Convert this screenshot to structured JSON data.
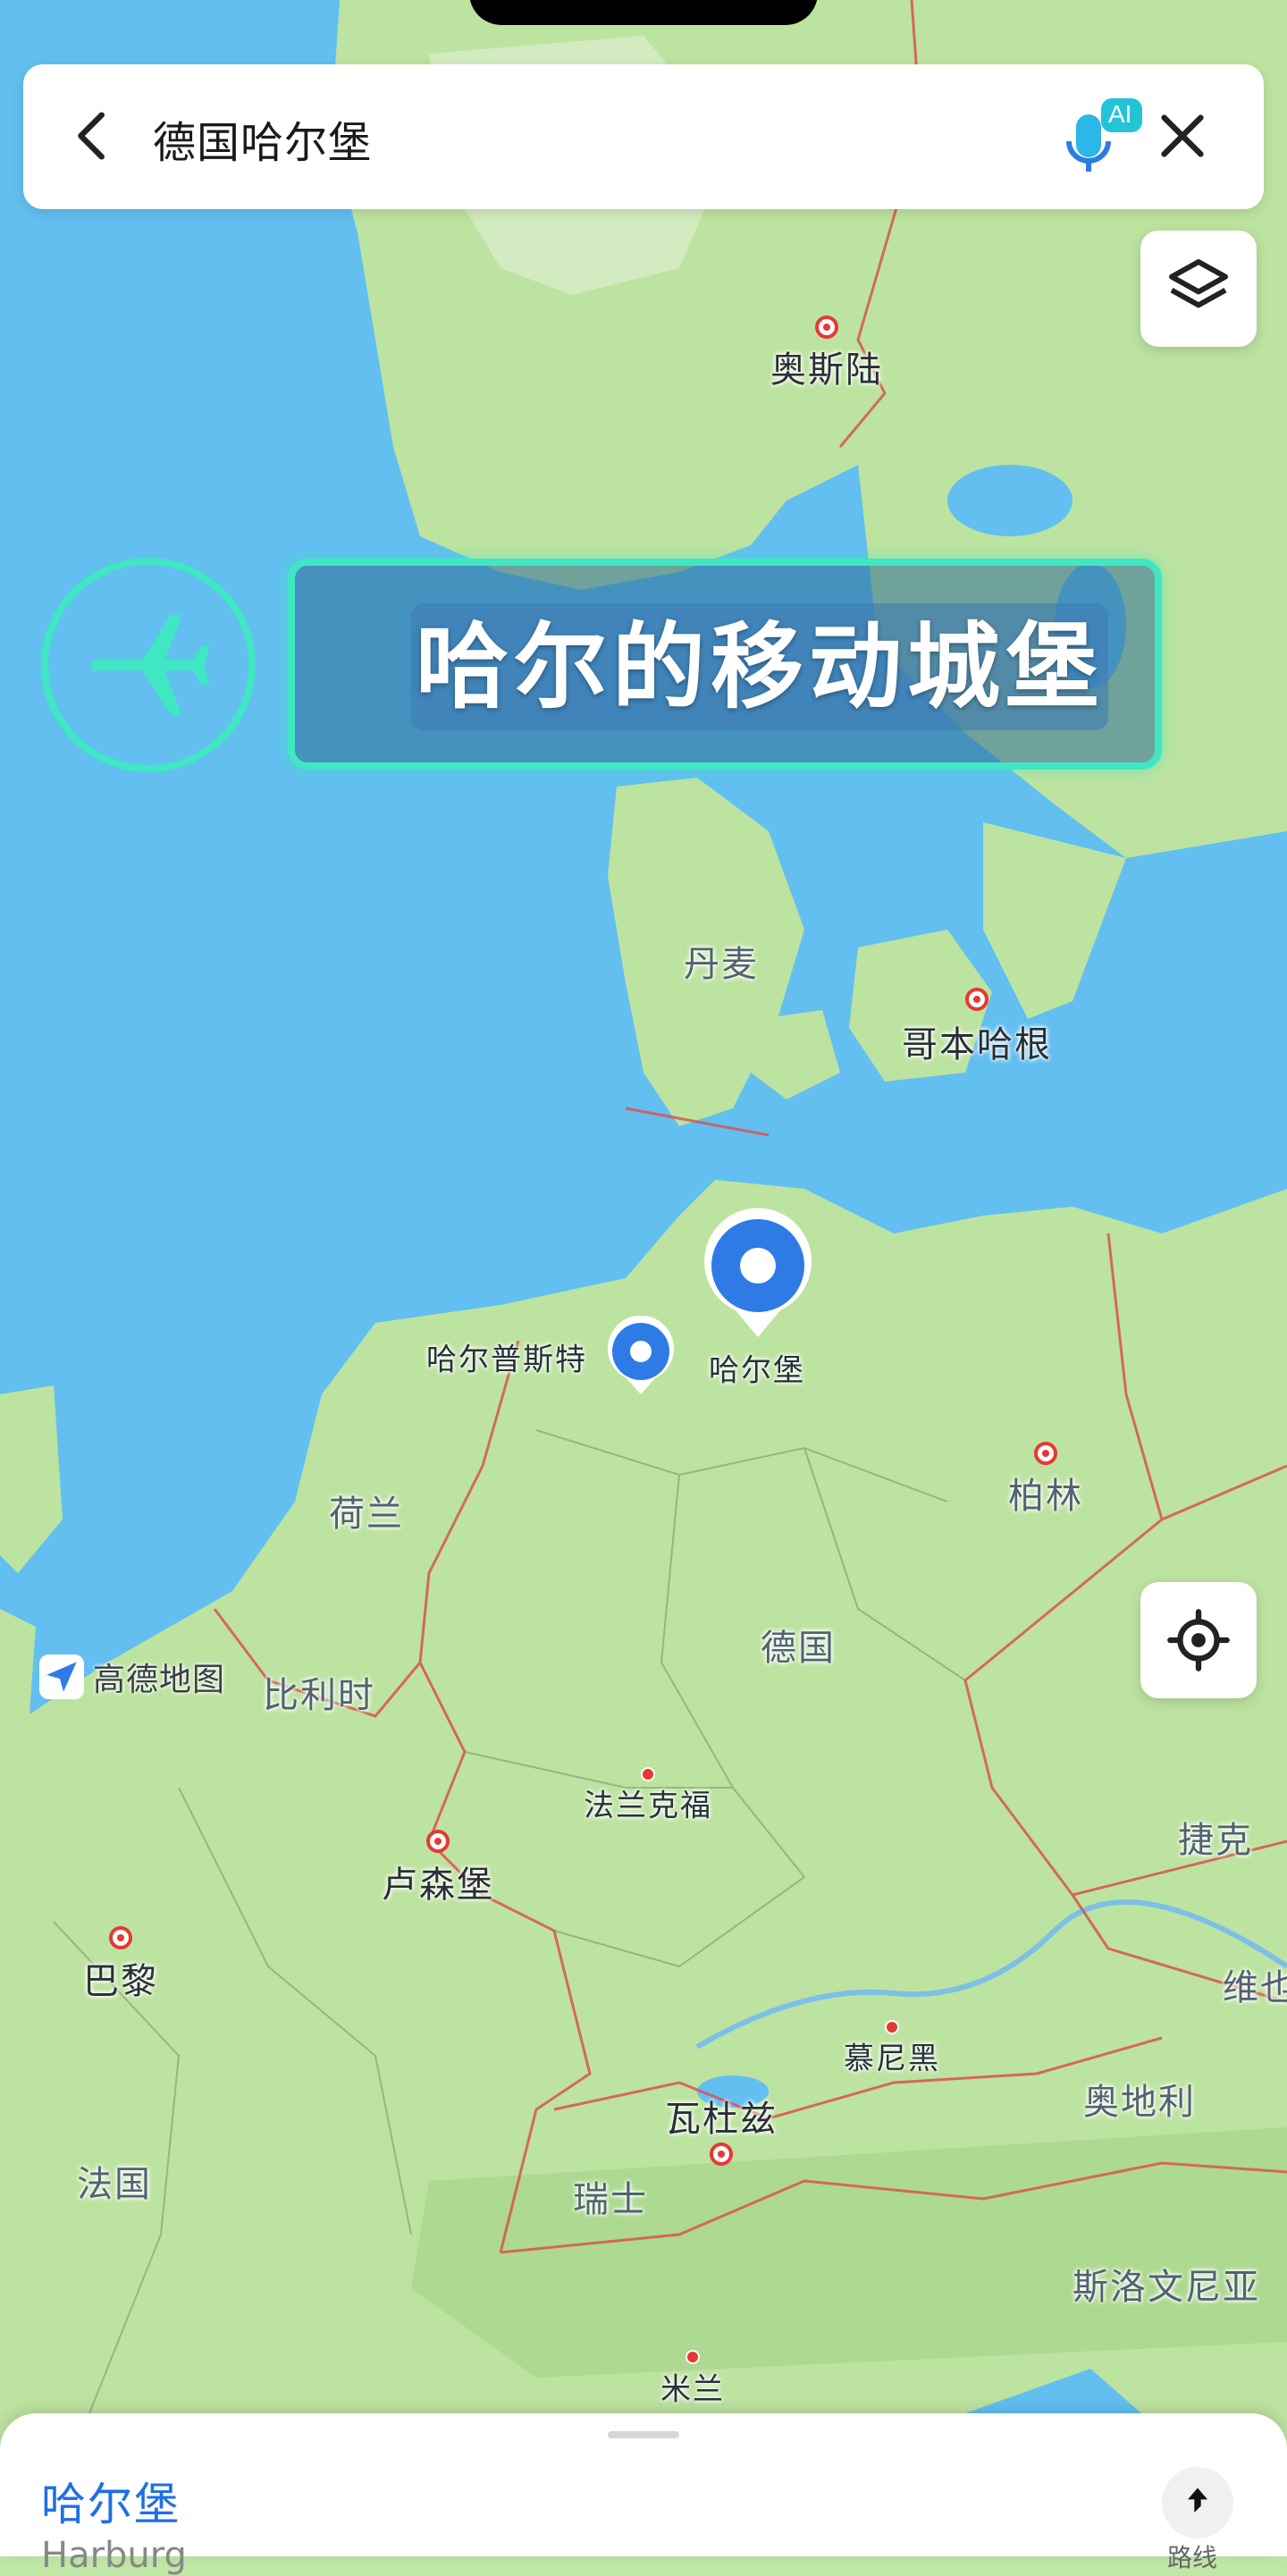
{
  "search": {
    "query": "德国哈尔堡",
    "ai_badge": "AI"
  },
  "banner": {
    "text": "哈尔的移动城堡"
  },
  "brand": {
    "name": "高德地图"
  },
  "map": {
    "labels": [
      {
        "key": "oslo",
        "text": "奥斯陆"
      },
      {
        "key": "denmark",
        "text": "丹麦"
      },
      {
        "key": "copenhagen",
        "text": "哥本哈根"
      },
      {
        "key": "harpstedt",
        "text": "哈尔普斯特"
      },
      {
        "key": "harburg",
        "text": "哈尔堡"
      },
      {
        "key": "berlin",
        "text": "柏林"
      },
      {
        "key": "netherlands",
        "text": "荷兰"
      },
      {
        "key": "germany",
        "text": "德国"
      },
      {
        "key": "belgium",
        "text": "比利时"
      },
      {
        "key": "frankfurt",
        "text": "法兰克福"
      },
      {
        "key": "czech",
        "text": "捷克"
      },
      {
        "key": "luxembourg",
        "text": "卢森堡"
      },
      {
        "key": "paris",
        "text": "巴黎"
      },
      {
        "key": "vienna",
        "text": "维也"
      },
      {
        "key": "munich",
        "text": "慕尼黑"
      },
      {
        "key": "vaduz",
        "text": "瓦杜兹"
      },
      {
        "key": "austria",
        "text": "奥地利"
      },
      {
        "key": "france",
        "text": "法国"
      },
      {
        "key": "switzerland",
        "text": "瑞士"
      },
      {
        "key": "slovenia",
        "text": "斯洛文尼亚"
      },
      {
        "key": "milan",
        "text": "米兰"
      }
    ]
  },
  "sheet": {
    "title": "哈尔堡",
    "subtitle": "Harburg",
    "route_label": "路线"
  },
  "colors": {
    "water": "#62bff0",
    "land": "#bde3a0",
    "accent": "#1f6fe5",
    "border": "#d9534f",
    "banner_border": "#3fe7c2"
  }
}
